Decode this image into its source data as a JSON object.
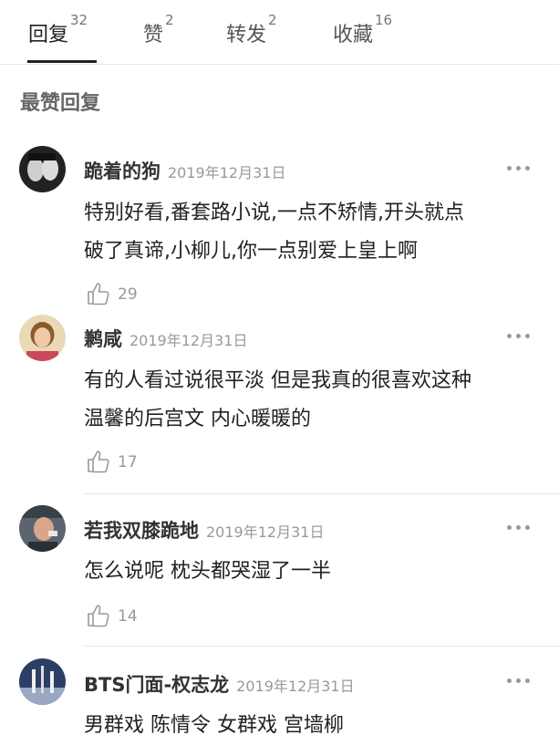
{
  "tabs": [
    {
      "label": "回复",
      "count": "32"
    },
    {
      "label": "赞",
      "count": "2"
    },
    {
      "label": "转发",
      "count": "2"
    },
    {
      "label": "收藏",
      "count": "16"
    }
  ],
  "section_title": "最赞回复",
  "comments": [
    {
      "name": "跪着的狗",
      "date": "2019年12月31日",
      "line1": "特别好看,番套路小说,一点不矫情,开头就点",
      "line2": "破了真谛,小柳儿,你一点别爱上皇上啊",
      "likes": "29"
    },
    {
      "name": "鹣咸",
      "date": "2019年12月31日",
      "line1": "有的人看过说很平淡 但是我真的很喜欢这种",
      "line2": "温馨的后宫文 内心暖暖的",
      "likes": "17"
    },
    {
      "name": "若我双膝跪地",
      "date": "2019年12月31日",
      "line1": "怎么说呢 枕头都哭湿了一半",
      "likes": "14"
    },
    {
      "name": "BTS门面-权志龙",
      "date": "2019年12月31日",
      "line1": "男群戏 陈情令 女群戏 宫墙柳"
    }
  ],
  "colors": {
    "text": "#222222",
    "muted": "#999999",
    "divider": "#e6e6e6"
  },
  "icons": [
    "thumbs-up-icon",
    "more-icon"
  ]
}
